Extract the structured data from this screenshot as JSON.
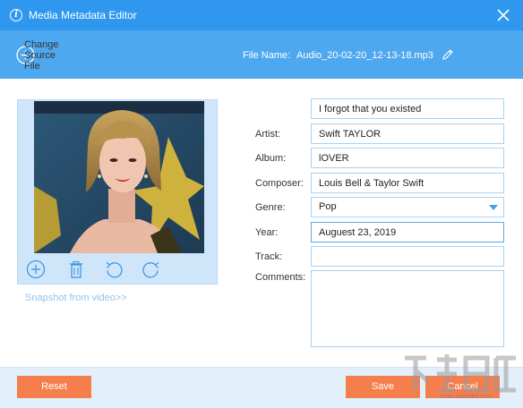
{
  "window": {
    "title": "Media Metadata Editor",
    "info_icon_glyph": "i"
  },
  "toolbar": {
    "change_source_label": "Change Source File",
    "file_name_label": "File Name:",
    "file_name_value": "Audio_20-02-20_12-13-18.mp3"
  },
  "art": {
    "snapshot_link": "Snapshot from video>>"
  },
  "fields": {
    "title_value": "I forgot that you existed",
    "artist_label": "Artist:",
    "artist_value": "Swift TAYLOR",
    "album_label": "Album:",
    "album_value": "lOVER",
    "composer_label": "Composer:",
    "composer_value": "Louis Bell & Taylor Swift",
    "genre_label": "Genre:",
    "genre_value": "Pop",
    "year_label": "Year:",
    "year_value": "Auguest 23, 2019",
    "track_label": "Track:",
    "track_value": "",
    "comments_label": "Comments:",
    "comments_value": ""
  },
  "buttons": {
    "reset": "Reset",
    "save": "Save",
    "cancel": "Cancel"
  },
  "watermark": {
    "text": "www.xiazaiba.com"
  },
  "colors": {
    "titlebar": "#2f97ee",
    "toolbar": "#4ea8f0",
    "accent_button": "#f57e4d",
    "art_panel": "#cfe6fa",
    "footer": "#e3f0fb"
  }
}
